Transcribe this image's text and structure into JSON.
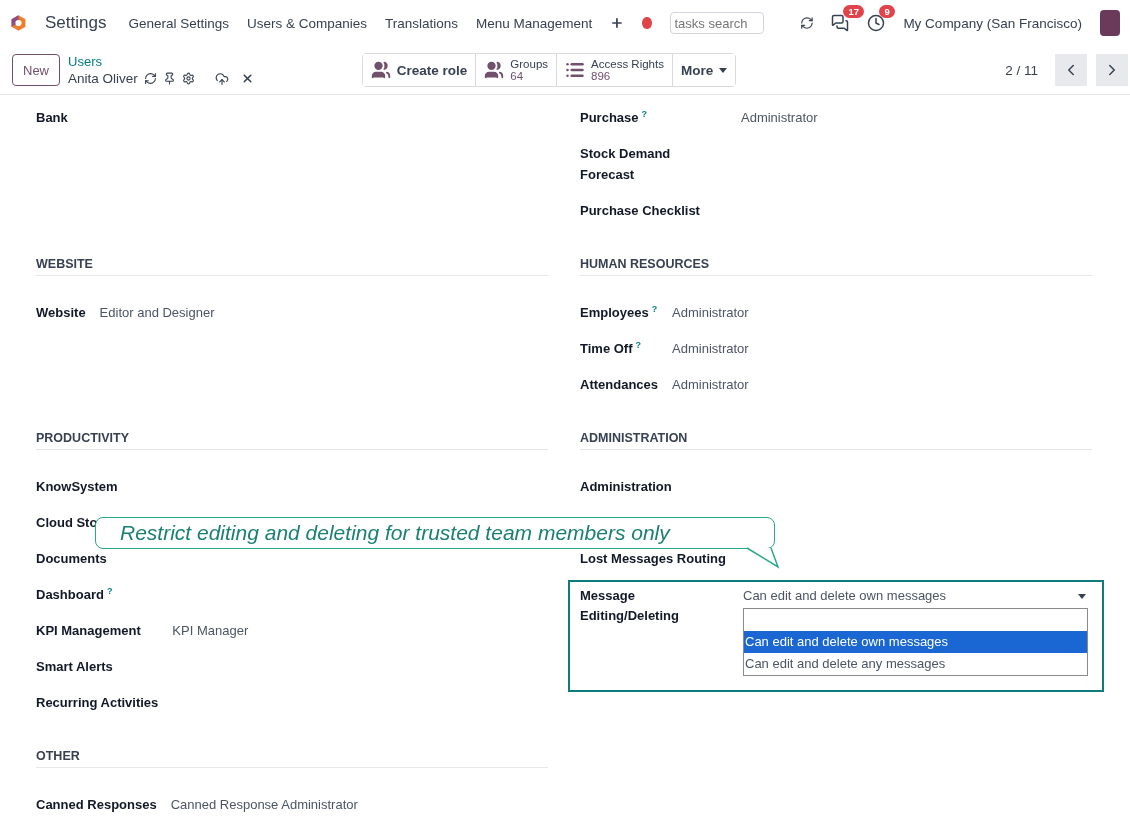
{
  "navbar": {
    "app": "Settings",
    "menu": [
      "General Settings",
      "Users & Companies",
      "Translations",
      "Menu Management"
    ],
    "search": {
      "placeholder": "tasks search"
    },
    "messages_badge": "17",
    "activities_badge": "9",
    "company": "My Company (San Francisco)"
  },
  "control_panel": {
    "new_button": "New",
    "breadcrumb": "Users",
    "record": "Anita Oliver",
    "buttons": [
      {
        "kind": "action",
        "label": "Create role"
      },
      {
        "kind": "stat",
        "label": "Groups",
        "count": "64"
      },
      {
        "kind": "stat",
        "label": "Access Rights",
        "count": "896"
      },
      {
        "kind": "more",
        "label": "More"
      }
    ],
    "pager": "2 / 11"
  },
  "rows": [
    {
      "left": {
        "fields": [
          {
            "label": "Bank"
          }
        ]
      },
      "right": {
        "fields": [
          {
            "label": "Purchase",
            "help": "?",
            "value": "Administrator"
          },
          {
            "label": "Stock Demand Forecast"
          },
          {
            "label": "Purchase Checklist"
          }
        ]
      }
    },
    {
      "left": {
        "heading": "WEBSITE",
        "fields": [
          {
            "label": "Website",
            "value": "Editor and Designer"
          }
        ]
      },
      "right": {
        "heading": "HUMAN RESOURCES",
        "fields": [
          {
            "label": "Employees",
            "help": "?",
            "value": "Administrator"
          },
          {
            "label": "Time Off",
            "help": "?",
            "value": "Administrator"
          },
          {
            "label": "Attendances",
            "value": "Administrator"
          }
        ]
      }
    },
    {
      "left": {
        "heading": "PRODUCTIVITY",
        "fields": [
          {
            "label": "KnowSystem"
          },
          {
            "label": "Cloud Sto"
          },
          {
            "label": "Documents"
          },
          {
            "label": "Dashboard",
            "help": "?"
          },
          {
            "label": "KPI Management",
            "value": "KPI Manager"
          },
          {
            "label": "Smart Alerts"
          },
          {
            "label": "Recurring Activities"
          }
        ]
      },
      "right": {
        "heading": "ADMINISTRATION",
        "fields": [
          {
            "label": "Administration"
          },
          {
            "kind": "covered"
          },
          {
            "label": "Lost Messages Routing"
          },
          {
            "kind": "select",
            "highlighted": true,
            "label": "Message Editing/Deleting",
            "value": "Can edit and delete own messages",
            "options": [
              {
                "label": "Can edit and delete own messages",
                "selected": true
              },
              {
                "label": "Can edit and delete any messages",
                "selected": false
              }
            ]
          }
        ]
      },
      "callout": "Restrict editing and deleting for trusted team members only"
    },
    {
      "left": {
        "heading": "OTHER",
        "fields": [
          {
            "label": "Canned Responses",
            "value": "Canned Response Administrator"
          }
        ]
      }
    }
  ]
}
